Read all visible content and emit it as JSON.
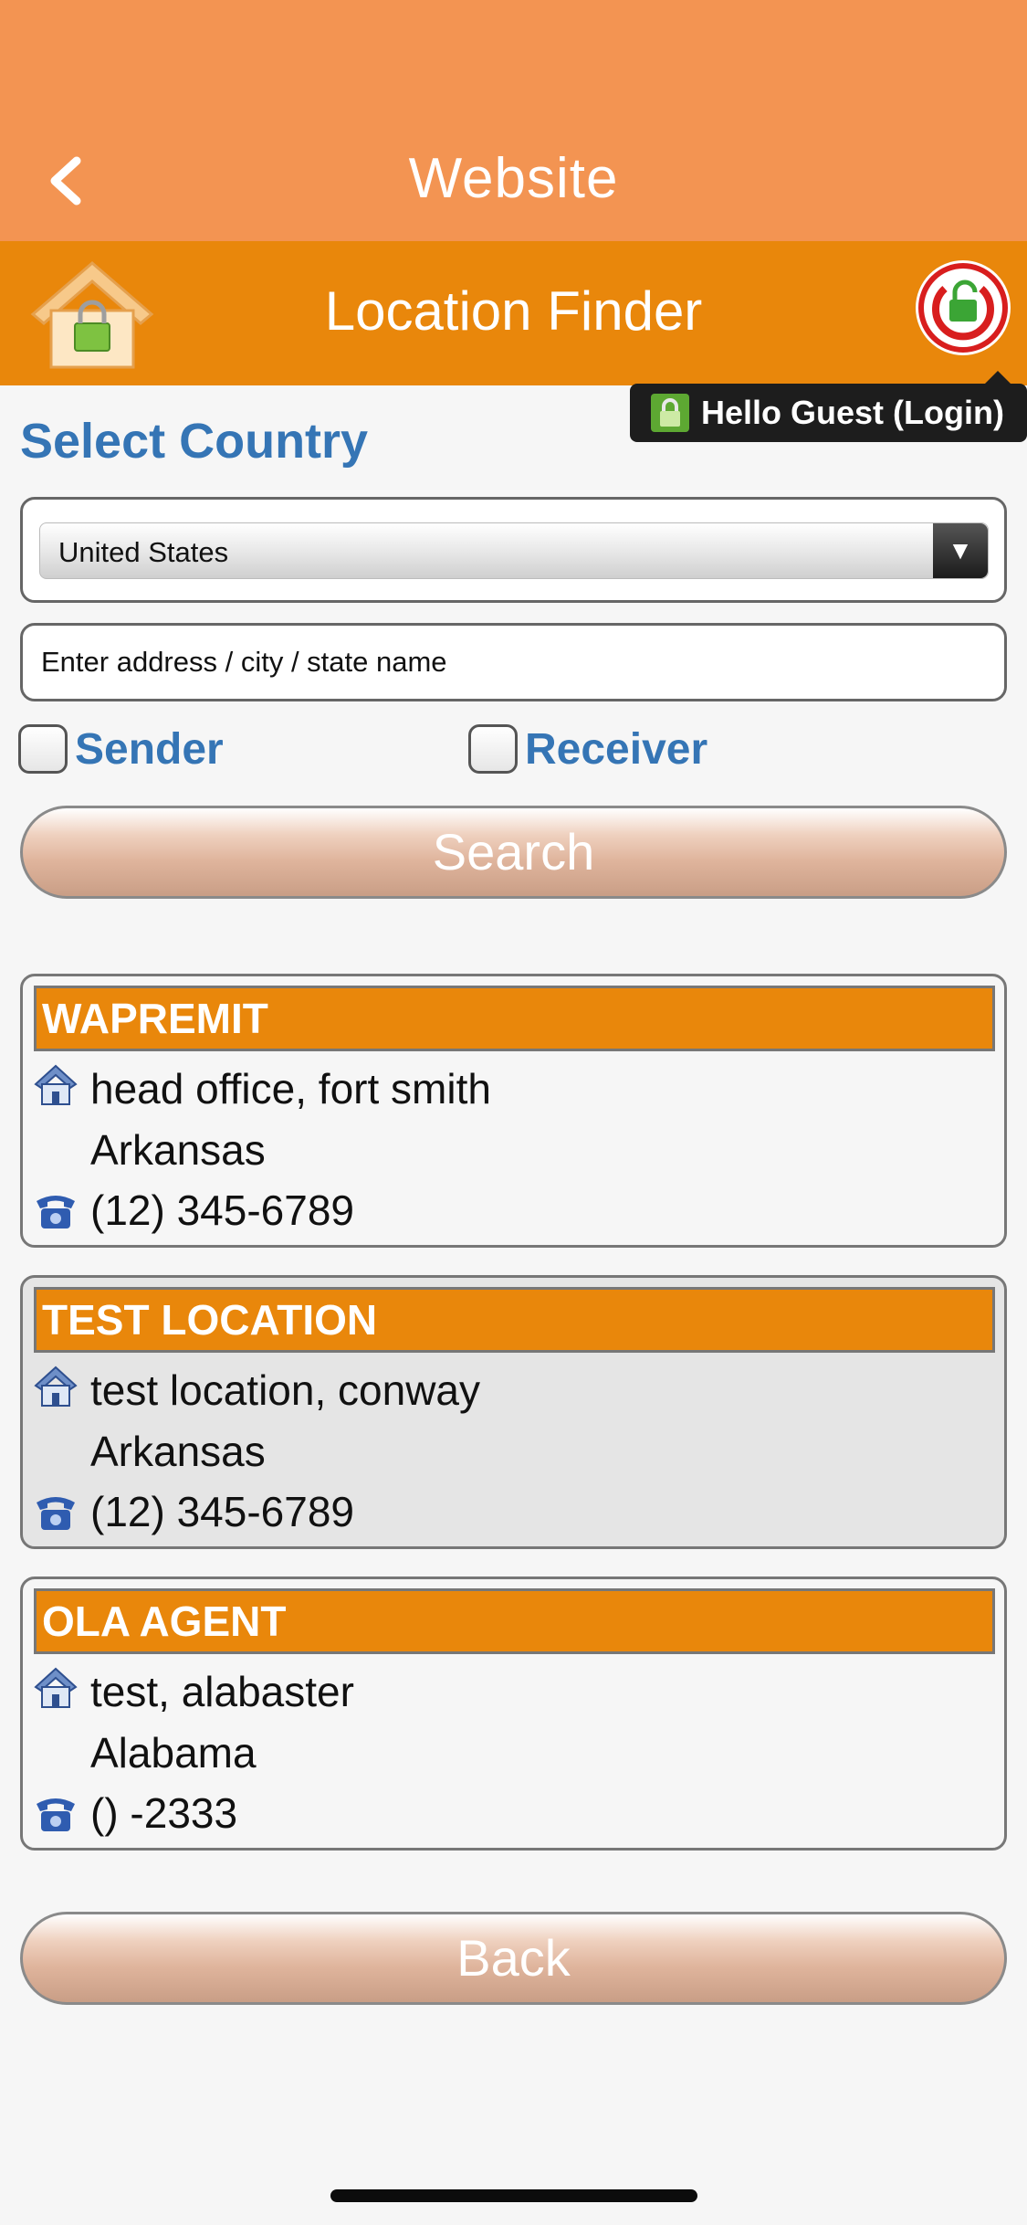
{
  "nav": {
    "title": "Website"
  },
  "header": {
    "title": "Location Finder"
  },
  "login_tooltip": {
    "text": "Hello Guest (Login)"
  },
  "form": {
    "section_label": "Select Country",
    "country_selected": "United States",
    "address_placeholder": "Enter address / city / state name",
    "sender_label": "Sender",
    "receiver_label": "Receiver",
    "search_label": "Search"
  },
  "results": [
    {
      "name": "WAPREMIT",
      "address": "head office, fort smith",
      "state": "Arkansas",
      "phone": "(12) 345-6789"
    },
    {
      "name": "TEST LOCATION",
      "address": "test location, conway",
      "state": "Arkansas",
      "phone": "(12) 345-6789"
    },
    {
      "name": "OLA AGENT",
      "address": "test, alabaster",
      "state": "Alabama",
      "phone": "() -2333"
    }
  ],
  "footer": {
    "back_label": "Back"
  },
  "icons": {
    "back": "chevron-left-icon",
    "home": "home-lock-icon",
    "logout": "power-lock-icon",
    "address": "house-icon",
    "phone": "telephone-icon"
  },
  "colors": {
    "nav_bg": "#f39452",
    "header_bg": "#e9870b",
    "accent_text": "#3575b5",
    "card_alt_bg": "#e5e5e5"
  }
}
